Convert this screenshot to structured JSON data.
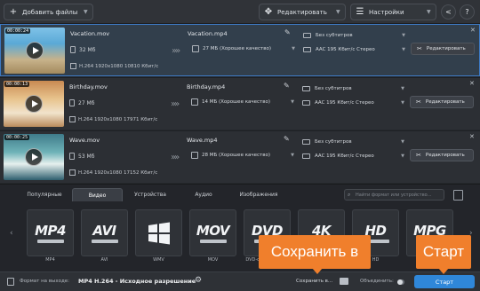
{
  "toolbar": {
    "add_files": "Добавить файлы",
    "edit": "Редактировать",
    "settings": "Настройки"
  },
  "files": [
    {
      "duration": "00:00:24",
      "name": "Vacation.mov",
      "size": "32 Мб",
      "codec": "H.264 1920x1080 10810 Кбит/с",
      "output_name": "Vacation.mp4",
      "output_quality": "27 МБ (Хорошее качество)",
      "subtitles": "Без субтитров",
      "audio": "AAC 195 Кбит/с Стерео",
      "edit_label": "Редактировать",
      "selected": true
    },
    {
      "duration": "00:00:13",
      "name": "Birthday.mov",
      "size": "27 Мб",
      "codec": "H.264 1920x1080 17971 Кбит/с",
      "output_name": "Birthday.mp4",
      "output_quality": "14 МБ (Хорошее качество)",
      "subtitles": "Без субтитров",
      "audio": "AAC 195 Кбит/с Стерео",
      "edit_label": "Редактировать",
      "selected": false
    },
    {
      "duration": "00:00:25",
      "name": "Wave.mov",
      "size": "53 Мб",
      "codec": "H.264 1920x1080 17152 Кбит/с",
      "output_name": "Wave.mp4",
      "output_quality": "28 МБ (Хорошее качество)",
      "subtitles": "Без субтитров",
      "audio": "AAC 195 Кбит/с Стерео",
      "edit_label": "Редактировать",
      "selected": false
    }
  ],
  "tabs": [
    "Популярные",
    "Видео",
    "Устройства",
    "Аудио",
    "Изображения"
  ],
  "active_tab": "Видео",
  "search_placeholder": "Найти формат или устройство...",
  "formats": [
    {
      "logo": "MP4",
      "label": "MP4"
    },
    {
      "logo": "AVI",
      "label": "AVI"
    },
    {
      "logo": "",
      "label": "WMV"
    },
    {
      "logo": "MOV",
      "label": "MOV"
    },
    {
      "logo": "DVD",
      "label": "DVD-совместимый"
    },
    {
      "logo": "4K",
      "label": "4K"
    },
    {
      "logo": "HD",
      "label": "HD"
    },
    {
      "logo": "MPG",
      "label": "MPG"
    }
  ],
  "bottom": {
    "format_label": "Формат на выходе:",
    "format_value": "MP4 H.264 - Исходное разрешение",
    "save_label": "Сохранить в...",
    "merge_label": "Объединить:",
    "start_label": "Старт"
  },
  "callouts": {
    "save": "Сохранить в",
    "start": "Старт"
  },
  "colors": {
    "accent_blue": "#2f87d9",
    "callout_orange": "#f07f2c",
    "selection_border": "#3d7ac4"
  }
}
